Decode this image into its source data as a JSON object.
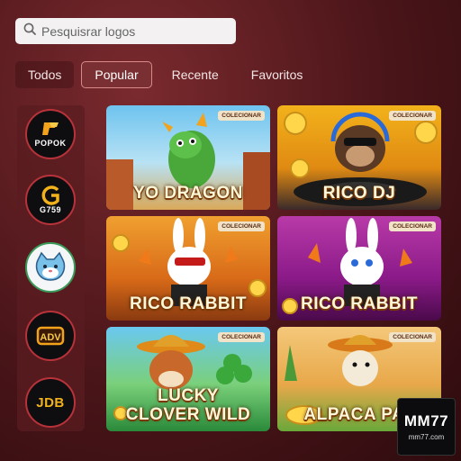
{
  "search": {
    "placeholder": "Pesquisrar logos",
    "icon": "search-icon"
  },
  "tabs": [
    {
      "label": "Todos"
    },
    {
      "label": "Popular",
      "active": true
    },
    {
      "label": "Recente"
    },
    {
      "label": "Favoritos"
    }
  ],
  "providers": [
    {
      "label": "POPOK",
      "icon": "popok-logo"
    },
    {
      "label": "G759",
      "icon": "g759-logo"
    },
    {
      "label": "",
      "icon": "cat-logo"
    },
    {
      "label": "",
      "icon": "tadv-logo"
    },
    {
      "label": "JDB",
      "icon": "jdb-logo"
    }
  ],
  "games": [
    {
      "title": "YO DRAGON",
      "badge": "COLECIONAR"
    },
    {
      "title": "RICO DJ",
      "badge": "COLECIONAR"
    },
    {
      "title": "RICO RABBIT",
      "badge": "COLECIONAR"
    },
    {
      "title": "RICO RABBIT",
      "badge": "COLECIONAR"
    },
    {
      "title": "LUCKY CLOVER WILD",
      "badge": "COLECIONAR"
    },
    {
      "title": "ALPACA PAY",
      "badge": "COLECIONAR"
    }
  ],
  "watermark": {
    "brand": "MM77",
    "site": "mm77.com"
  },
  "colors": {
    "accent": "#7a2f32",
    "active_border": "#d98a88",
    "background": "#4a1519"
  }
}
